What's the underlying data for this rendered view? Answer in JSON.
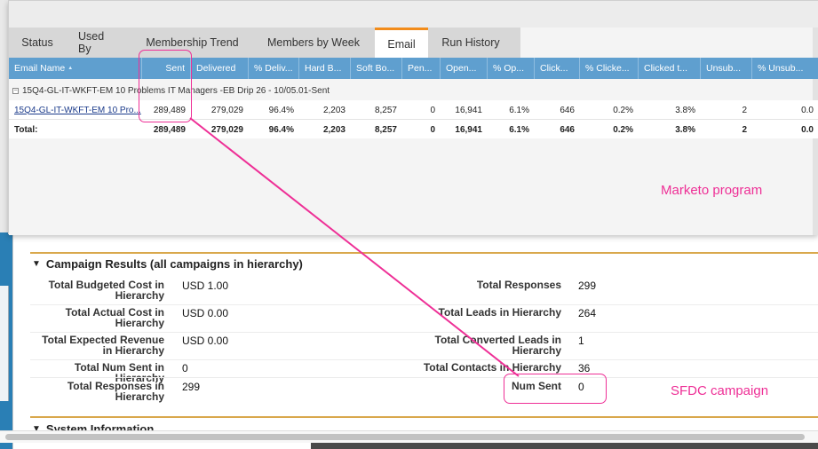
{
  "marketo": {
    "tabs": [
      {
        "label": "Status",
        "active": false
      },
      {
        "label": "Used By",
        "active": false
      },
      {
        "label": "Membership Trend",
        "active": false
      },
      {
        "label": "Members by Week",
        "active": false
      },
      {
        "label": "Email",
        "active": true
      },
      {
        "label": "Run History",
        "active": false
      }
    ],
    "accent_color": "#f28c1b",
    "header_color": "#5f9fcf",
    "columns": [
      "Email Name",
      "Sent",
      "Delivered",
      "% Deliv...",
      "Hard B...",
      "Soft Bo...",
      "Pen...",
      "Open...",
      "% Op...",
      "Click...",
      "% Clicke...",
      "Clicked t...",
      "Unsub...",
      "% Unsub..."
    ],
    "group_label": "15Q4-GL-IT-WKFT-EM 10 Problems IT Managers -EB Drip 26 - 10/05.01-Sent",
    "row": [
      "15Q4-GL-IT-WKFT-EM 10 Pro...",
      "289,489",
      "279,029",
      "96.4%",
      "2,203",
      "8,257",
      "0",
      "16,941",
      "6.1%",
      "646",
      "0.2%",
      "3.8%",
      "2",
      "0.0"
    ],
    "total": [
      "Total:",
      "289,489",
      "279,029",
      "96.4%",
      "2,203",
      "8,257",
      "0",
      "16,941",
      "6.1%",
      "646",
      "0.2%",
      "3.8%",
      "2",
      "0.0"
    ]
  },
  "sfdc": {
    "campaign_section_title": "Campaign Results (all campaigns in hierarchy)",
    "system_section_title": "System Information",
    "left_fields": [
      {
        "label": "Total Budgeted Cost in Hierarchy",
        "value": "USD 1.00"
      },
      {
        "label": "Total Actual Cost in Hierarchy",
        "value": "USD 0.00"
      },
      {
        "label": "Total Expected Revenue in Hierarchy",
        "value": "USD 0.00"
      },
      {
        "label": "Total Num Sent in Hierarchy",
        "value": "0"
      },
      {
        "label": "Total Responses in Hierarchy",
        "value": "299"
      }
    ],
    "right_fields": [
      {
        "label": "Total Responses",
        "value": "299"
      },
      {
        "label": "Total Leads in Hierarchy",
        "value": "264"
      },
      {
        "label": "Total Converted Leads in Hierarchy",
        "value": "1"
      },
      {
        "label": "Total Contacts in Hierarchy",
        "value": "36"
      },
      {
        "label": "Num Sent",
        "value": "0"
      }
    ],
    "gold_color": "#d9a84c"
  },
  "annotations": {
    "marketo_label": "Marketo program",
    "sfdc_label": "SFDC campaign",
    "color": "#ee2f96"
  }
}
